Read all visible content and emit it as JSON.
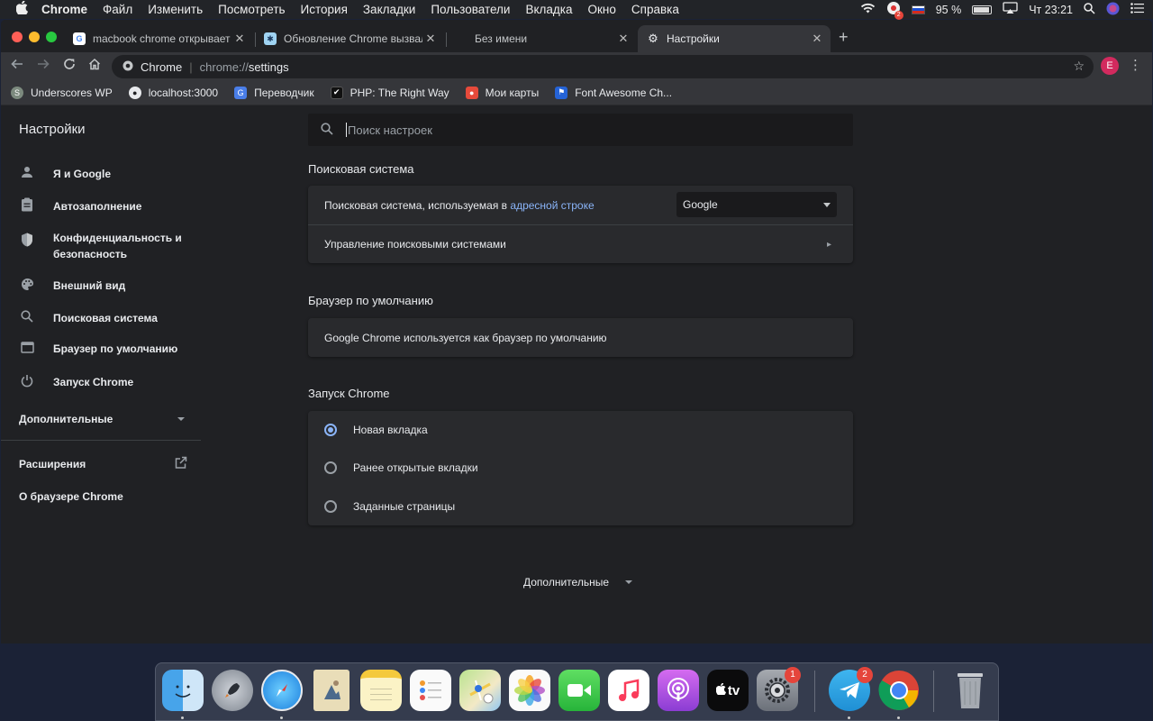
{
  "menubar": {
    "apple": "",
    "items": [
      "Chrome",
      "Файл",
      "Изменить",
      "Посмотреть",
      "История",
      "Закладки",
      "Пользователи",
      "Вкладка",
      "Окно",
      "Справка"
    ],
    "battery": "95 %",
    "clock": "Чт 23:21",
    "badge": "2"
  },
  "tabs": [
    {
      "title": "macbook chrome открывает п"
    },
    {
      "title": "Обновление Chrome вызвало"
    },
    {
      "title": "Без имени"
    },
    {
      "title": "Настройки"
    }
  ],
  "omnibox": {
    "site": "Chrome",
    "divider": "|",
    "scheme": "chrome://",
    "path": "settings"
  },
  "profile_initial": "E",
  "bookmarks": [
    {
      "label": "Underscores WP",
      "color": "#7c8a7e",
      "glyph": "S"
    },
    {
      "label": "localhost:3000",
      "color": "#3c4043",
      "glyph": "◉"
    },
    {
      "label": "Переводчик",
      "color": "#4a7ee8",
      "glyph": "G"
    },
    {
      "label": "PHP: The Right Way",
      "color": "#111111",
      "glyph": "✔"
    },
    {
      "label": "Мои карты",
      "color": "#e64a3b",
      "glyph": "⬤"
    },
    {
      "label": "Font Awesome Ch...",
      "color": "#2563d6",
      "glyph": "⚑"
    }
  ],
  "settings": {
    "title": "Настройки",
    "search_placeholder": "Поиск настроек"
  },
  "sidebar": {
    "items": [
      {
        "label": "Я и Google",
        "icon": "person-icon"
      },
      {
        "label": "Автозаполнение",
        "icon": "clipboard-icon"
      },
      {
        "label": "Конфиденциальность и",
        "label2": "безопасность",
        "icon": "shield-icon"
      },
      {
        "label": "Внешний вид",
        "icon": "palette-icon"
      },
      {
        "label": "Поисковая система",
        "icon": "search-icon"
      },
      {
        "label": "Браузер по умолчанию",
        "icon": "browser-icon"
      },
      {
        "label": "Запуск Chrome",
        "icon": "power-icon"
      }
    ],
    "advanced": "Дополнительные",
    "extensions": "Расширения",
    "about": "О браузере Chrome"
  },
  "search_engine": {
    "section_title": "Поисковая система",
    "row1_prefix": "Поисковая система, используемая в",
    "row1_link": "адресной строке",
    "selected_engine": "Google",
    "row2": "Управление поисковыми системами"
  },
  "default_browser": {
    "section_title": "Браузер по умолчанию",
    "status": "Google Chrome используется как браузер по умолчанию"
  },
  "startup": {
    "section_title": "Запуск Chrome",
    "options": [
      "Новая вкладка",
      "Ранее открытые вкладки",
      "Заданные страницы"
    ],
    "selected_index": 0
  },
  "advanced_bottom": "Дополнительные",
  "dock": {
    "apps": [
      "finder",
      "launchpad",
      "safari",
      "mail",
      "notes",
      "reminders",
      "maps",
      "photos",
      "facetime",
      "music",
      "podcasts",
      "tv",
      "system-preferences",
      "telegram",
      "chrome",
      "trash"
    ],
    "tv_label": "tv",
    "badges": {
      "system_preferences": "1",
      "telegram": "2"
    }
  }
}
